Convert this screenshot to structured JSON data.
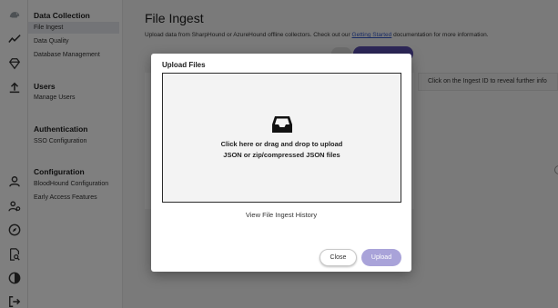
{
  "sidebar": {
    "sections": [
      {
        "title": "Data Collection",
        "items": [
          "File Ingest",
          "Data Quality",
          "Database Management"
        ]
      },
      {
        "title": "Users",
        "items": [
          "Manage Users"
        ]
      },
      {
        "title": "Authentication",
        "items": [
          "SSO Configuration"
        ]
      },
      {
        "title": "Configuration",
        "items": [
          "BloodHound Configuration",
          "Early Access Features"
        ]
      }
    ],
    "active_item": "File Ingest"
  },
  "page": {
    "title": "File Ingest",
    "description_prefix": "Upload data from SharpHound or AzureHound offline collectors. Check out our",
    "description_link": "Getting Started",
    "description_suffix": "documentation for more information.",
    "info_text": "Click on the Ingest ID to reveal further info"
  },
  "modal": {
    "title": "Upload Files",
    "dropzone_line1": "Click here or drag and drop to upload",
    "dropzone_line2": "JSON or zip/compressed JSON files",
    "history_link": "View File Ingest History",
    "close_label": "Close",
    "upload_label": "Upload"
  },
  "icons": {
    "rail": [
      "app-logo-icon",
      "trend-icon",
      "gem-icon",
      "upload-icon",
      "user-icon",
      "admin-users-icon",
      "compass-icon",
      "search-doc-icon",
      "contrast-icon",
      "logout-icon"
    ],
    "dropzone": "inbox-tray-icon"
  },
  "colors": {
    "primary": "#5a4fb0",
    "upload_disabled": "#a9a3d9",
    "link": "#3057c8"
  }
}
